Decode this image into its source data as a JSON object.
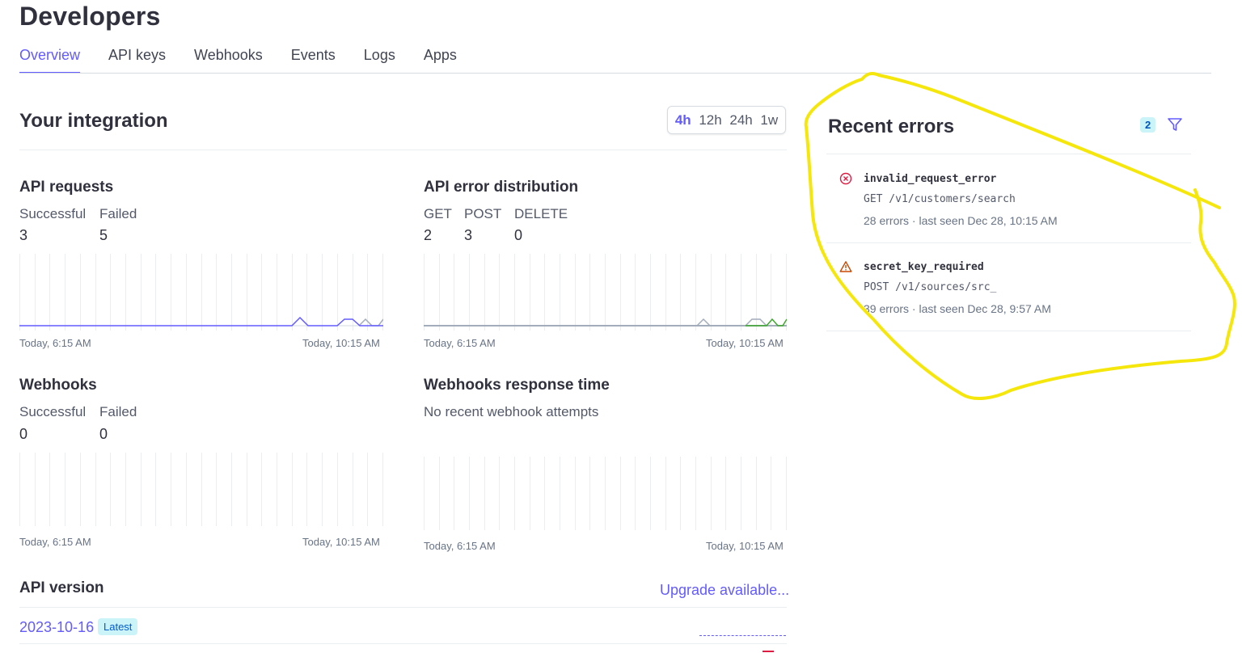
{
  "page": {
    "title": "Developers"
  },
  "tabs": [
    {
      "label": "Overview",
      "active": true
    },
    {
      "label": "API keys"
    },
    {
      "label": "Webhooks"
    },
    {
      "label": "Events"
    },
    {
      "label": "Logs"
    },
    {
      "label": "Apps"
    }
  ],
  "integration": {
    "title": "Your integration",
    "ranges": [
      "4h",
      "12h",
      "24h",
      "1w"
    ],
    "selected_range": "4h"
  },
  "api_requests": {
    "title": "API requests",
    "stats": [
      {
        "label": "Successful",
        "value": "3"
      },
      {
        "label": "Failed",
        "value": "5"
      }
    ],
    "x_start": "Today, 6:15 AM",
    "x_end": "Today, 10:15 AM"
  },
  "api_error_distribution": {
    "title": "API error distribution",
    "stats": [
      {
        "label": "GET",
        "value": "2"
      },
      {
        "label": "POST",
        "value": "3"
      },
      {
        "label": "DELETE",
        "value": "0"
      }
    ],
    "x_start": "Today, 6:15 AM",
    "x_end": "Today, 10:15 AM"
  },
  "webhooks": {
    "title": "Webhooks",
    "stats": [
      {
        "label": "Successful",
        "value": "0"
      },
      {
        "label": "Failed",
        "value": "0"
      }
    ],
    "x_start": "Today, 6:15 AM",
    "x_end": "Today, 10:15 AM"
  },
  "webhooks_response": {
    "title": "Webhooks response time",
    "empty_text": "No recent webhook attempts",
    "x_start": "Today, 6:15 AM",
    "x_end": "Today, 10:15 AM"
  },
  "api_version": {
    "title": "API version",
    "upgrade_link": "Upgrade available...",
    "version": "2023-10-16",
    "badge": "Latest"
  },
  "recent_errors": {
    "title": "Recent errors",
    "count": "2",
    "items": [
      {
        "icon": "error-circle-icon",
        "name": "invalid_request_error",
        "path": "GET /v1/customers/search",
        "meta": "28 errors · last seen Dec 28, 10:15 AM"
      },
      {
        "icon": "warning-triangle-icon",
        "name": "secret_key_required",
        "path": "POST /v1/sources/src_",
        "meta": "39 errors · last seen Dec 28, 9:57 AM"
      }
    ]
  },
  "colors": {
    "accent": "#635bff",
    "annotation": "#f5e60c",
    "error": "#df1b41",
    "warning": "#c84801",
    "success_series": "#3ea82c",
    "gray_series": "#a3acba"
  }
}
